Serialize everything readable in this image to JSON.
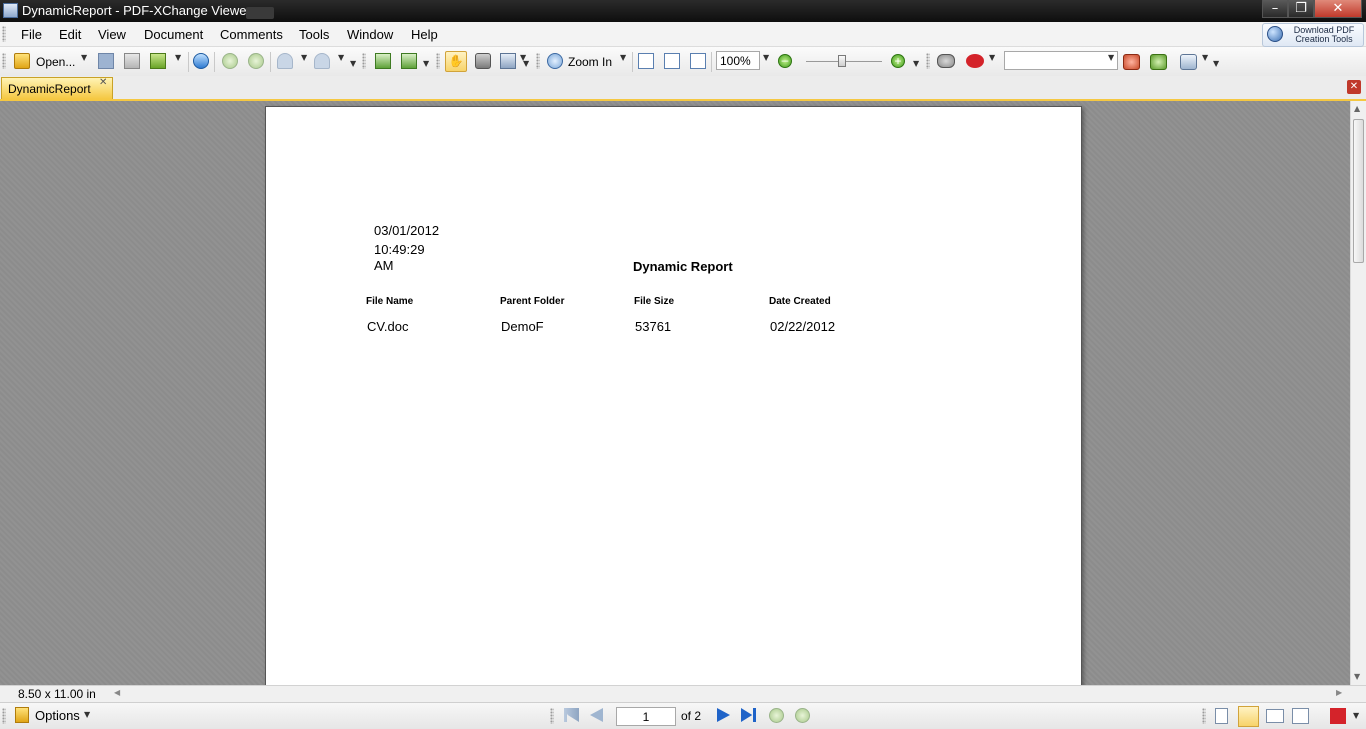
{
  "window": {
    "title": "DynamicReport - PDF-XChange Viewer",
    "minimize_label": "–",
    "maximize_label": "❐",
    "close_label": "✕"
  },
  "menu": {
    "items": [
      "File",
      "Edit",
      "View",
      "Document",
      "Comments",
      "Tools",
      "Window",
      "Help"
    ]
  },
  "download_button": {
    "line1": "Download PDF",
    "line2": "Creation Tools"
  },
  "toolbar": {
    "open_label": "Open...",
    "zoom_in_label": "Zoom In",
    "zoom_value": "100%",
    "search_value": ""
  },
  "tabs": {
    "active_tab": "DynamicReport",
    "close_label": "✕"
  },
  "document": {
    "date": "03/01/2012",
    "time": "10:49:29",
    "ampm": "AM",
    "title": "Dynamic Report",
    "columns": [
      "File Name",
      "Parent Folder",
      "File Size",
      "Date Created"
    ],
    "rows": [
      [
        "CV.doc",
        "DemoF",
        "53761",
        "02/22/2012"
      ]
    ]
  },
  "status": {
    "page_size": "8.50 x 11.00 in",
    "options_label": "Options",
    "current_page": "1",
    "total_pages": "of 2"
  },
  "colors": {
    "tab_accent": "#f5c842",
    "viewer_bg": "#8c8c8c",
    "nav_blue": "#1f63c8",
    "nav_green": "#7fbf3f"
  }
}
